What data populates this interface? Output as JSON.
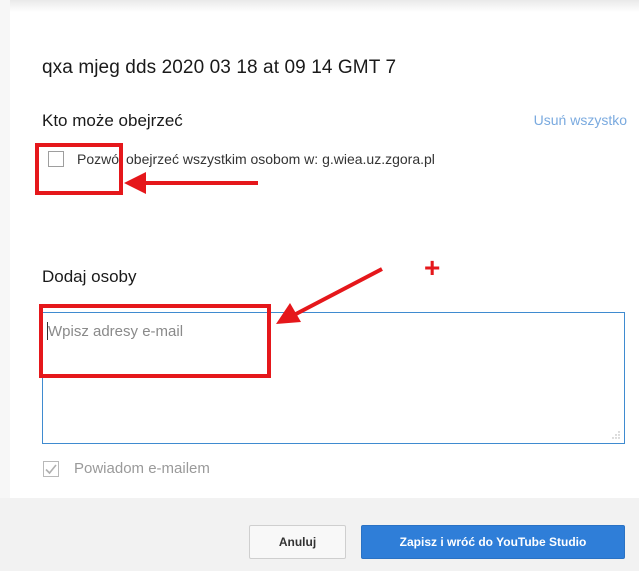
{
  "dialog": {
    "title": "qxa mjeg dds 2020 03 18 at 09 14 GMT 7",
    "who_can_view_label": "Kto może obejrzeć",
    "remove_all_link": "Usuń wszystko",
    "domain_checkbox": {
      "label": "Pozwól obejrzeć wszystkim osobom w: g.wiea.uz.zgora.pl",
      "checked": false
    },
    "add_people_label": "Dodaj osoby",
    "email_input": {
      "placeholder": "Wpisz adresy e-mail",
      "value": ""
    },
    "notify_checkbox": {
      "label": "Powiadom e-mailem",
      "checked": true,
      "disabled": true
    },
    "buttons": {
      "cancel": "Anuluj",
      "save": "Zapisz i wróć do YouTube Studio"
    }
  },
  "annotations": {
    "color": "#e5171b",
    "plus_sign": "+"
  },
  "colors": {
    "link": "#7aaadf",
    "input_border": "#3f8bd0",
    "primary_button": "#2f7ed8"
  }
}
